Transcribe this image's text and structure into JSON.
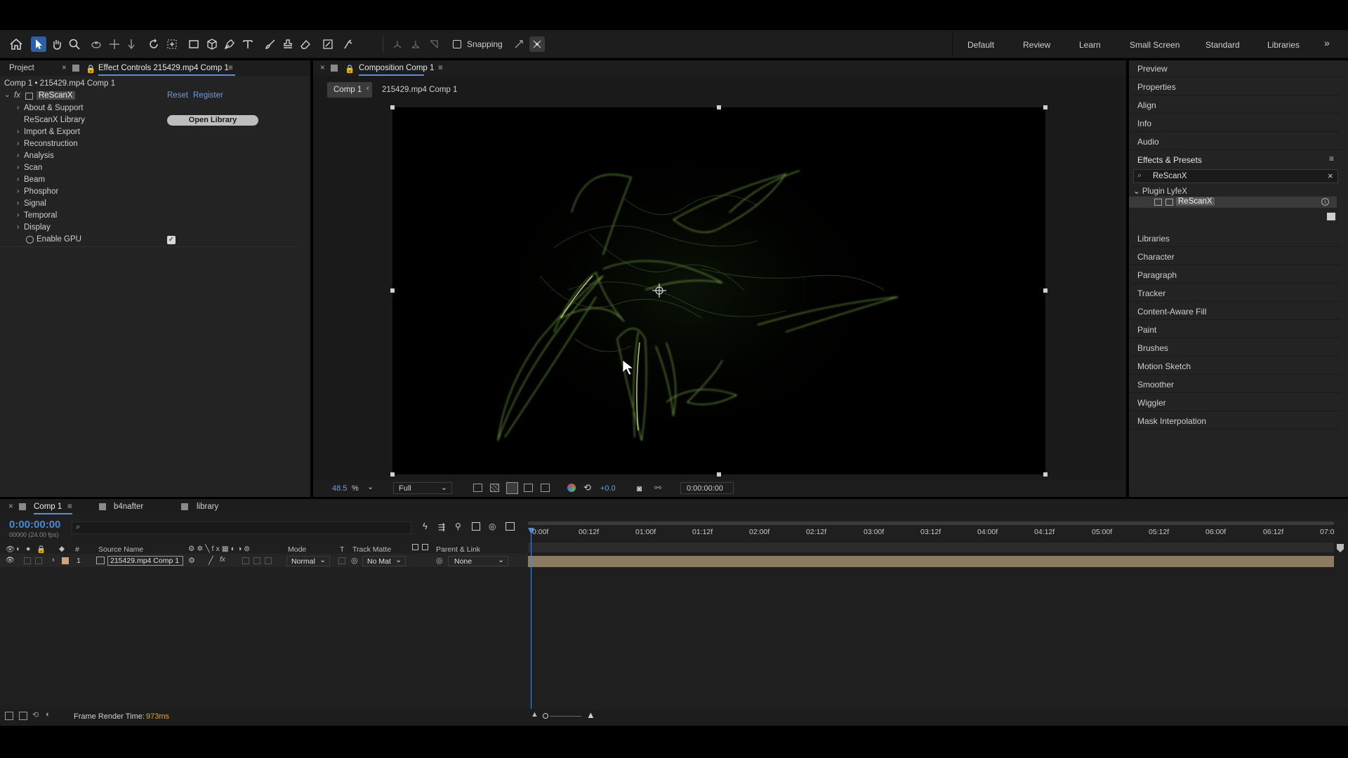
{
  "toolbar": {
    "snapping_label": "Snapping",
    "workspaces": [
      "Default",
      "Review",
      "Learn",
      "Small Screen",
      "Standard",
      "Libraries"
    ]
  },
  "project_panel": {
    "tab_project": "Project",
    "tab_effect_controls": "Effect Controls 215429.mp4 Comp 1",
    "breadcrumb": "Comp 1 • 215429.mp4 Comp 1",
    "effect_name": "ReScanX",
    "reset_label": "Reset",
    "register_label": "Register",
    "library_label": "ReScanX Library",
    "open_library_button": "Open Library",
    "groups": [
      "About & Support",
      "Import & Export",
      "Reconstruction",
      "Analysis",
      "Scan",
      "Beam",
      "Phosphor",
      "Signal",
      "Temporal",
      "Display"
    ],
    "enable_gpu_label": "Enable GPU",
    "enable_gpu_checked": true
  },
  "composition": {
    "tab_label": "Composition Comp 1",
    "crumb_active": "Comp 1",
    "crumb_next": "215429.mp4 Comp 1",
    "zoom_value": "48.5",
    "zoom_unit": "%",
    "resolution": "Full",
    "exposure": "+0.0",
    "timecode": "0:00:00:00"
  },
  "right_panel": {
    "items_top": [
      "Preview",
      "Properties",
      "Align",
      "Info",
      "Audio"
    ],
    "effects_presets_label": "Effects & Presets",
    "search_value": "ReScanX",
    "tree_folder": "Plugin LyfeX",
    "tree_item": "ReScanX",
    "items_bottom": [
      "Libraries",
      "Character",
      "Paragraph",
      "Tracker",
      "Content-Aware Fill",
      "Paint",
      "Brushes",
      "Motion Sketch",
      "Smoother",
      "Wiggler",
      "Mask Interpolation"
    ]
  },
  "timeline": {
    "tabs": [
      "Comp 1",
      "b4nafter",
      "library"
    ],
    "timecode": "0:00:00:00",
    "timecode_sub": "00000 (24.00 fps)",
    "headers": {
      "hash": "#",
      "source_name": "Source Name",
      "mode": "Mode",
      "t": "T",
      "track_matte": "Track Matte",
      "parent_link": "Parent & Link"
    },
    "ruler": [
      "0:00f",
      "00:12f",
      "01:00f",
      "01:12f",
      "02:00f",
      "02:12f",
      "03:00f",
      "03:12f",
      "04:00f",
      "04:12f",
      "05:00f",
      "05:12f",
      "06:00f",
      "06:12f",
      "07:0"
    ],
    "layer": {
      "number": "1",
      "name": "215429.mp4 Comp 1",
      "mode": "Normal",
      "track_matte": "No Mat",
      "parent": "None"
    }
  },
  "status": {
    "render_label": "Frame Render Time:",
    "render_value": "973ms"
  },
  "colors": {
    "accent_blue": "#2d5ea8",
    "timecode_blue": "#4a8ad4",
    "render_orange": "#e8a33c",
    "layer_bar": "#8c7b62"
  }
}
